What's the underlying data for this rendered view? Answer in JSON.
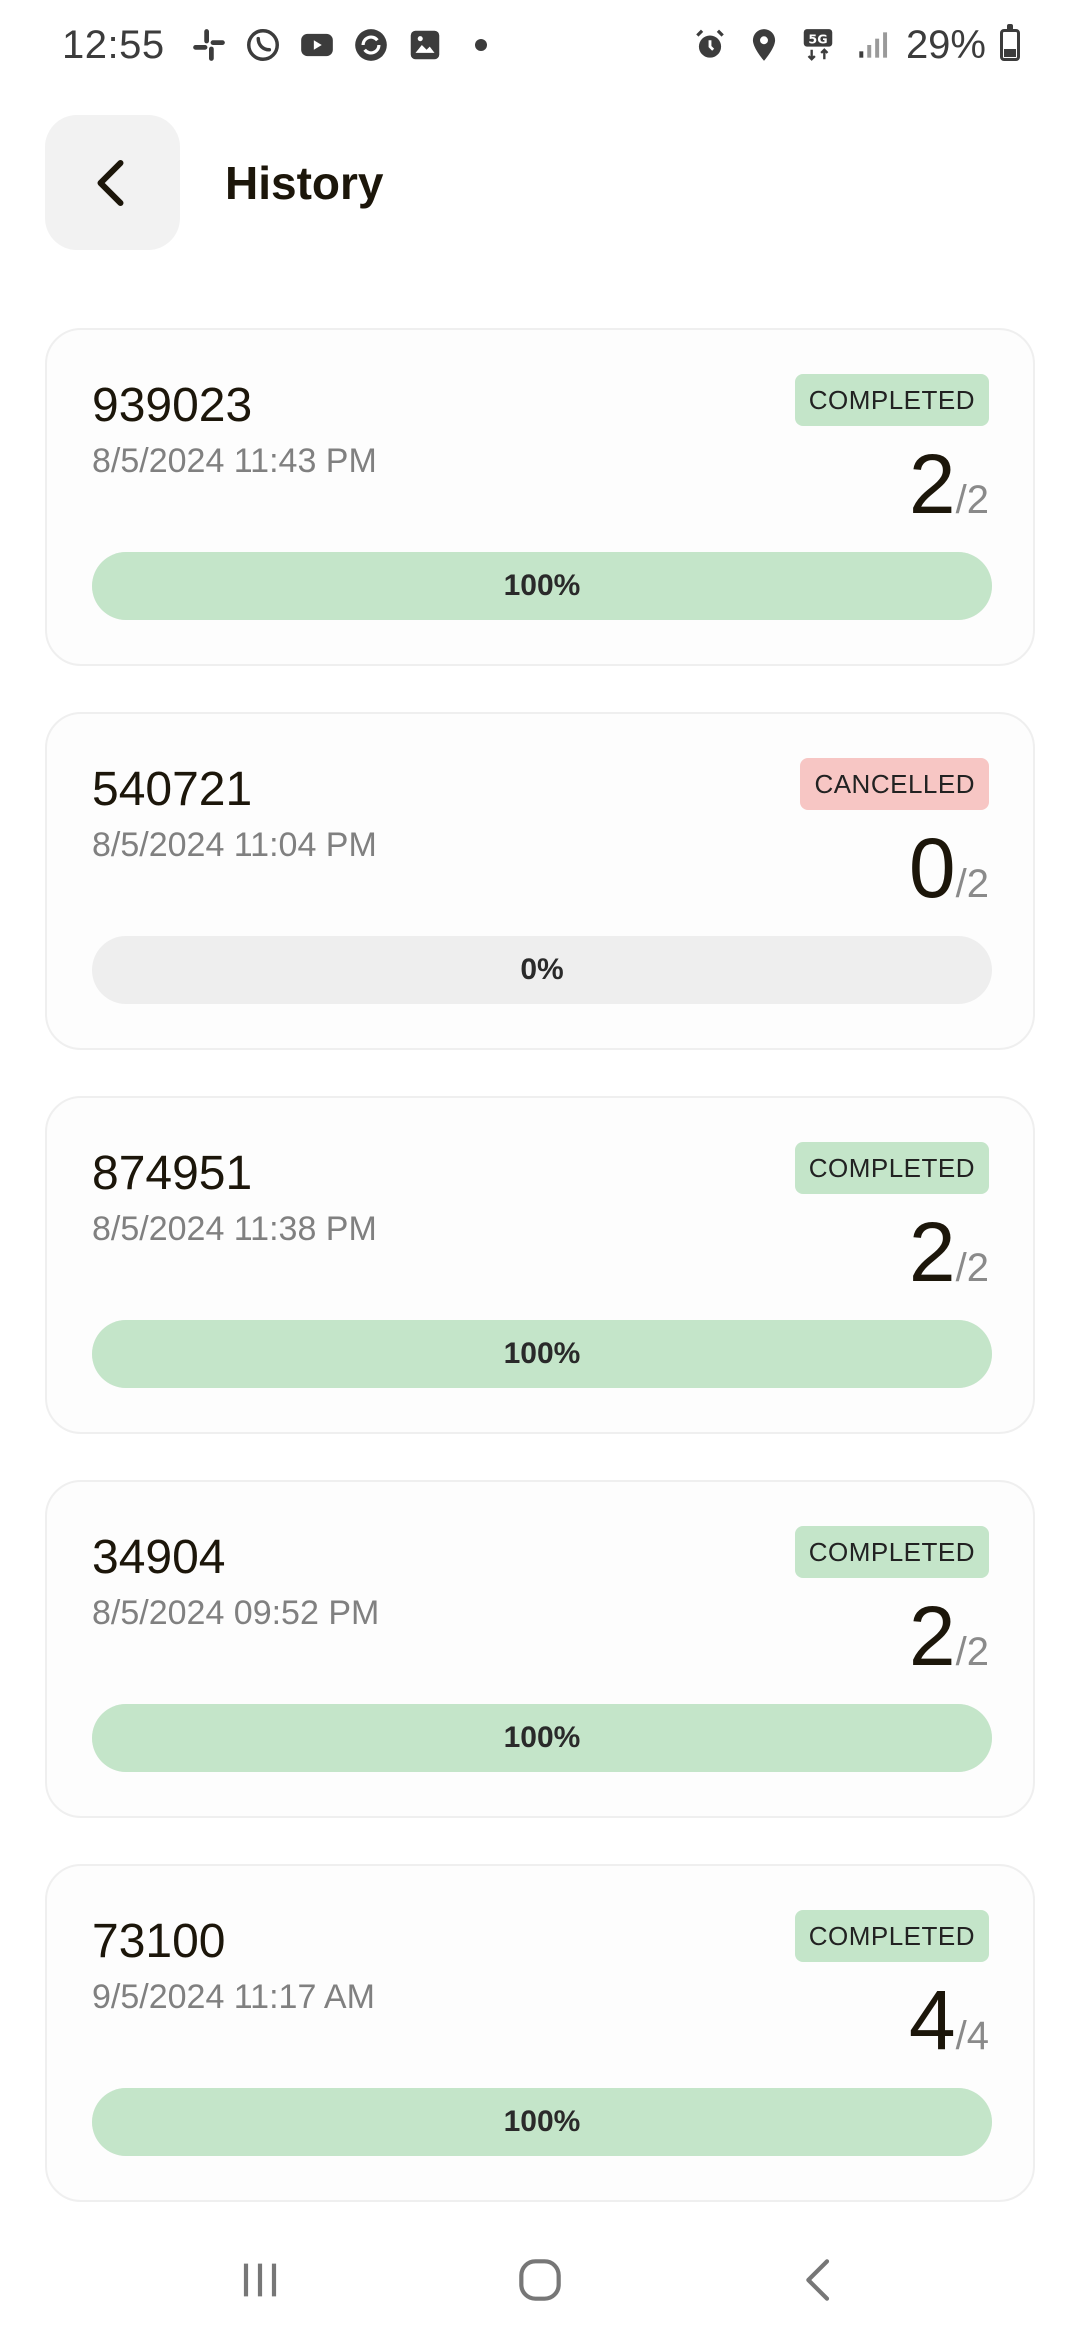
{
  "status_bar": {
    "time": "12:55",
    "battery": "29%",
    "left_icons": [
      "slack-icon",
      "whatsapp-icon",
      "youtube-icon",
      "sync-app-icon",
      "gallery-icon"
    ],
    "right_icons": [
      "alarm-icon",
      "location-icon",
      "5g-icon",
      "signal-icon",
      "battery-icon"
    ]
  },
  "header": {
    "title": "History",
    "back_icon": "chevron-left-icon"
  },
  "colors": {
    "completed_bg": "#c4e5c9",
    "cancelled_bg": "#f7c6c4",
    "progress_track": "#eeeeee",
    "text_primary": "#1c160a",
    "text_secondary": "#808080"
  },
  "sessions": [
    {
      "id": "939023",
      "date": "8/5/2024 11:43 PM",
      "status": "COMPLETED",
      "status_type": "completed",
      "done": "2",
      "total": "/2",
      "progress_label": "100%",
      "progress_fraction": 1.0
    },
    {
      "id": "540721",
      "date": "8/5/2024 11:04 PM",
      "status": "CANCELLED",
      "status_type": "cancelled",
      "done": "0",
      "total": "/2",
      "progress_label": "0%",
      "progress_fraction": 0.0
    },
    {
      "id": "874951",
      "date": "8/5/2024 11:38 PM",
      "status": "COMPLETED",
      "status_type": "completed",
      "done": "2",
      "total": "/2",
      "progress_label": "100%",
      "progress_fraction": 1.0
    },
    {
      "id": "34904",
      "date": "8/5/2024 09:52 PM",
      "status": "COMPLETED",
      "status_type": "completed",
      "done": "2",
      "total": "/2",
      "progress_label": "100%",
      "progress_fraction": 1.0
    },
    {
      "id": "73100",
      "date": "9/5/2024 11:17 AM",
      "status": "COMPLETED",
      "status_type": "completed",
      "done": "4",
      "total": "/4",
      "progress_label": "100%",
      "progress_fraction": 1.0
    }
  ],
  "nav_bar": {
    "recents_icon": "recents-icon",
    "home_icon": "home-icon",
    "back_icon": "back-icon"
  }
}
